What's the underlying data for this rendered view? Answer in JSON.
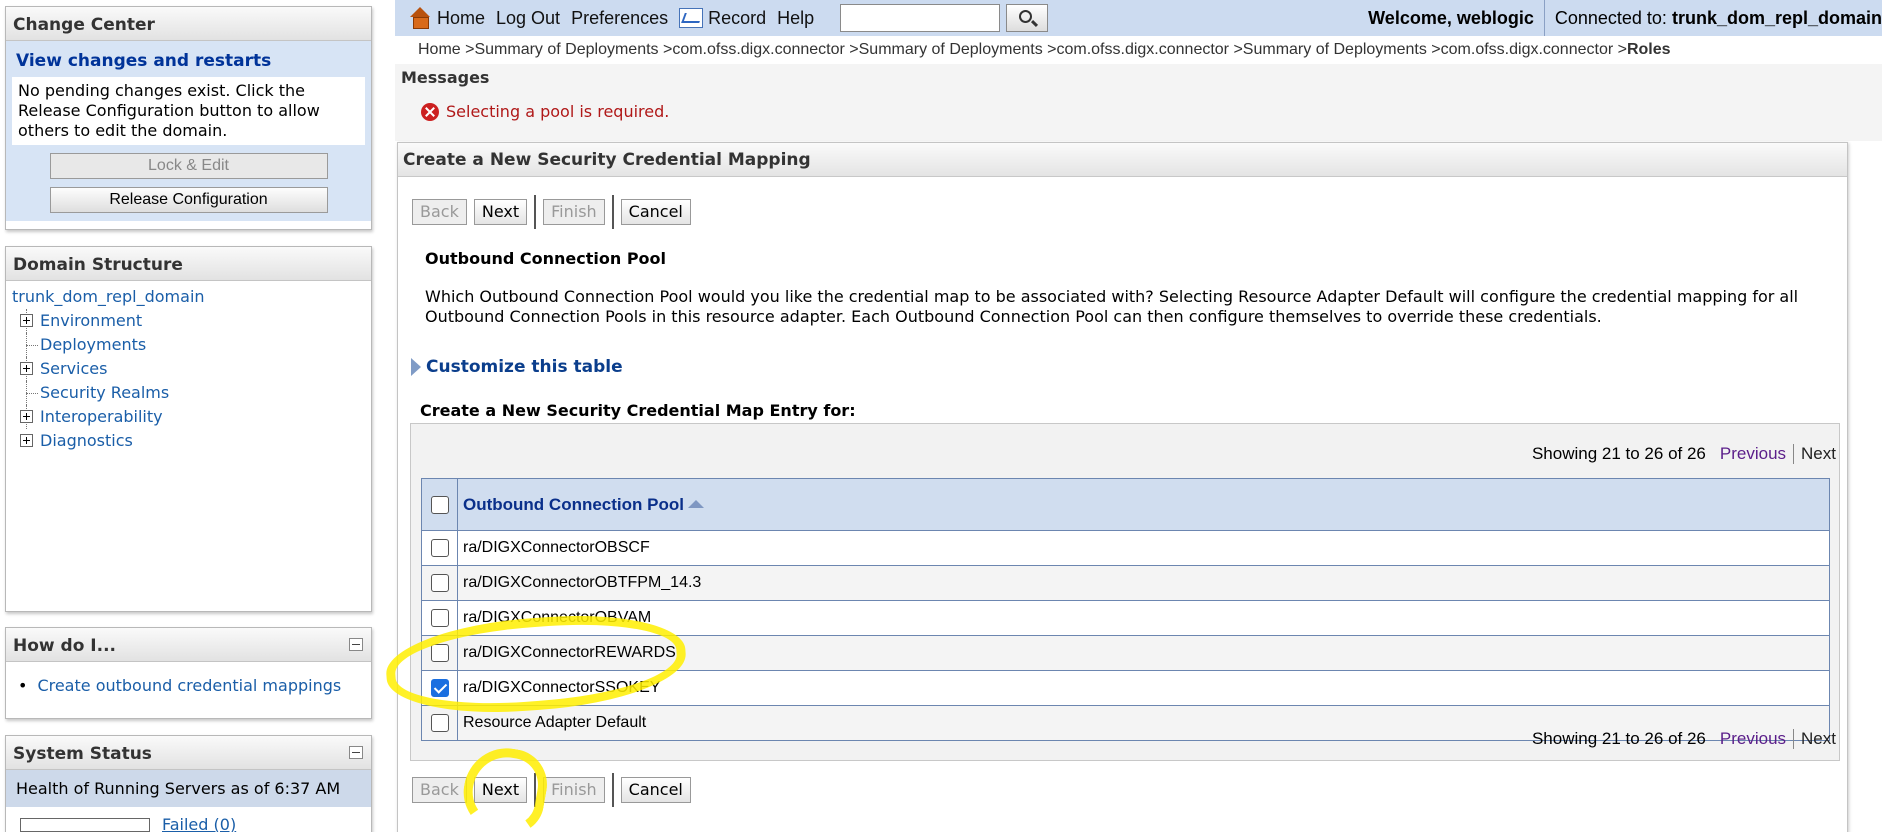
{
  "change_center": {
    "title": "Change Center",
    "subtitle": "View changes and restarts",
    "message": "No pending changes exist. Click the Release Configuration button to allow others to edit the domain.",
    "lock_edit_label": "Lock & Edit",
    "release_label": "Release Configuration"
  },
  "domain_structure": {
    "title": "Domain Structure",
    "root": "trunk_dom_repl_domain",
    "items": [
      {
        "label": "Environment",
        "expandable": true
      },
      {
        "label": "Deployments",
        "expandable": false
      },
      {
        "label": "Services",
        "expandable": true
      },
      {
        "label": "Security Realms",
        "expandable": false
      },
      {
        "label": "Interoperability",
        "expandable": true
      },
      {
        "label": "Diagnostics",
        "expandable": true
      }
    ]
  },
  "how_do_i": {
    "title": "How do I...",
    "items": [
      "Create outbound credential mappings"
    ]
  },
  "system_status": {
    "title": "System Status",
    "health_label": "Health of Running Servers as of  6:37 AM",
    "failed_label": "Failed (0)"
  },
  "topbar": {
    "home": "Home",
    "logout": "Log Out",
    "preferences": "Preferences",
    "record": "Record",
    "help": "Help",
    "search_value": "",
    "welcome": "Welcome, weblogic",
    "connected_prefix": "Connected to:",
    "connected_domain": "trunk_dom_repl_domain"
  },
  "breadcrumb": {
    "path": "Home >Summary of Deployments >com.ofss.digx.connector >Summary of Deployments >com.ofss.digx.connector >Summary of Deployments >com.ofss.digx.connector >",
    "current": "Roles"
  },
  "messages": {
    "title": "Messages",
    "error": "Selecting a pool is required."
  },
  "form": {
    "title": "Create a New Security Credential Mapping",
    "back": "Back",
    "next": "Next",
    "finish": "Finish",
    "cancel": "Cancel",
    "section_title": "Outbound Connection Pool",
    "section_desc": "Which Outbound Connection Pool would you like the credential map to be associated with? Selecting Resource Adapter Default will configure the credential mapping for all Outbound Connection Pools in this resource adapter. Each Outbound Connection Pool can then configure themselves to override these credentials.",
    "customize": "Customize this table",
    "table_title": "Create a New Security Credential Map Entry for:"
  },
  "table": {
    "showing": "Showing 21 to 26 of 26",
    "previous": "Previous",
    "next": "Next",
    "column": "Outbound Connection Pool",
    "rows": [
      {
        "name": "ra/DIGXConnectorOBSCF",
        "checked": false
      },
      {
        "name": "ra/DIGXConnectorOBTFPM_14.3",
        "checked": false
      },
      {
        "name": "ra/DIGXConnectorOBVAM",
        "checked": false
      },
      {
        "name": "ra/DIGXConnectorREWARDS",
        "checked": false
      },
      {
        "name": "ra/DIGXConnectorSSOKEY",
        "checked": true
      },
      {
        "name": "Resource Adapter Default",
        "checked": false
      }
    ]
  },
  "colors": {
    "accent": "#003399",
    "highlight": "#ffee00",
    "error": "#b01818"
  }
}
